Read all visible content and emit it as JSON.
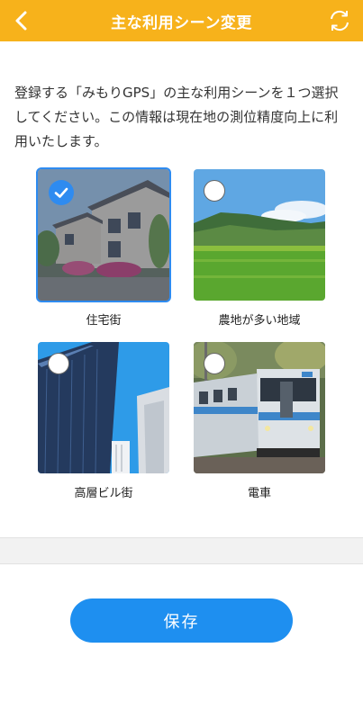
{
  "header": {
    "title": "主な利用シーン変更",
    "background": "#F7B21B"
  },
  "description": "登録する「みもりGPS」の主な利用シーンを１つ選択してください。この情報は現在地の測位精度向上に利用いたします。",
  "scenes": [
    {
      "label": "住宅街",
      "selected": true,
      "icon": "residential-photo"
    },
    {
      "label": "農地が多い地域",
      "selected": false,
      "icon": "farmland-photo"
    },
    {
      "label": "高層ビル街",
      "selected": false,
      "icon": "skyscraper-photo"
    },
    {
      "label": "電車",
      "selected": false,
      "icon": "train-photo"
    }
  ],
  "save_button": {
    "label": "保存",
    "color": "#1E8FF0"
  },
  "colors": {
    "accent": "#2E8BF0",
    "separator": "#F2F2F2"
  }
}
